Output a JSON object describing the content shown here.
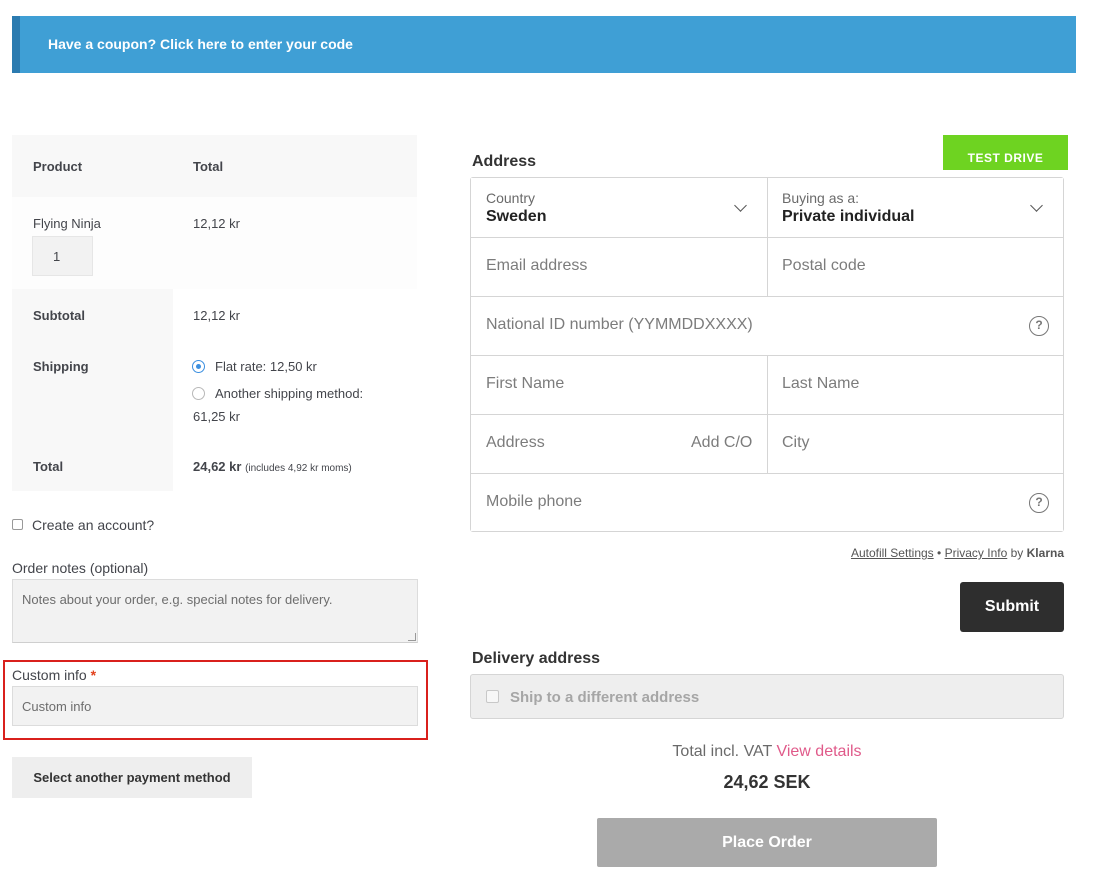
{
  "coupon": {
    "text": "Have a coupon? Click here to enter your code"
  },
  "order": {
    "col_product": "Product",
    "col_total": "Total",
    "item": {
      "name": "Flying Ninja",
      "qty": "1",
      "total": "12,12 kr"
    },
    "subtotal_label": "Subtotal",
    "subtotal_value": "12,12 kr",
    "shipping_label": "Shipping",
    "shipping_options": [
      {
        "label": "Flat rate: 12,50 kr",
        "selected": true
      },
      {
        "label": "Another shipping method:",
        "price": "61,25 kr",
        "selected": false
      }
    ],
    "total_label": "Total",
    "total_value": "24,62 kr",
    "total_tax_note": "(includes 4,92 kr moms)"
  },
  "account": {
    "label": "Create an account?"
  },
  "notes": {
    "label": "Order notes (optional)",
    "placeholder": "Notes about your order, e.g. special notes for delivery."
  },
  "custom": {
    "label": "Custom info",
    "required_mark": "*",
    "placeholder": "Custom info"
  },
  "payment_button": "Select another payment method",
  "klarna": {
    "address_title": "Address",
    "test_drive": "TEST DRIVE",
    "country_label": "Country",
    "country_value": "Sweden",
    "buying_label": "Buying as a:",
    "buying_value": "Private individual",
    "email": "Email address",
    "postal": "Postal code",
    "national_id": "National ID number (YYMMDDXXXX)",
    "first_name": "First Name",
    "last_name": "Last Name",
    "address": "Address",
    "add_co": "Add C/O",
    "city": "City",
    "mobile": "Mobile phone",
    "help_glyph": "?",
    "autofill": "Autofill Settings",
    "bullet": "•",
    "privacy": "Privacy Info",
    "by": "by",
    "brand": "Klarna",
    "submit": "Submit",
    "delivery_title": "Delivery address",
    "ship_different": "Ship to a different address",
    "total_incl": "Total incl. VAT",
    "view_details": "View details",
    "total_amount": "24,62 SEK",
    "place_order": "Place Order"
  },
  "colors": {
    "banner": "#3f9fd5",
    "test_drive": "#6ed321",
    "link_pink": "#e05a8a",
    "highlight": "#d9201c"
  },
  "icons": {
    "dropdown": "chevron-down-icon",
    "help": "help-icon"
  }
}
